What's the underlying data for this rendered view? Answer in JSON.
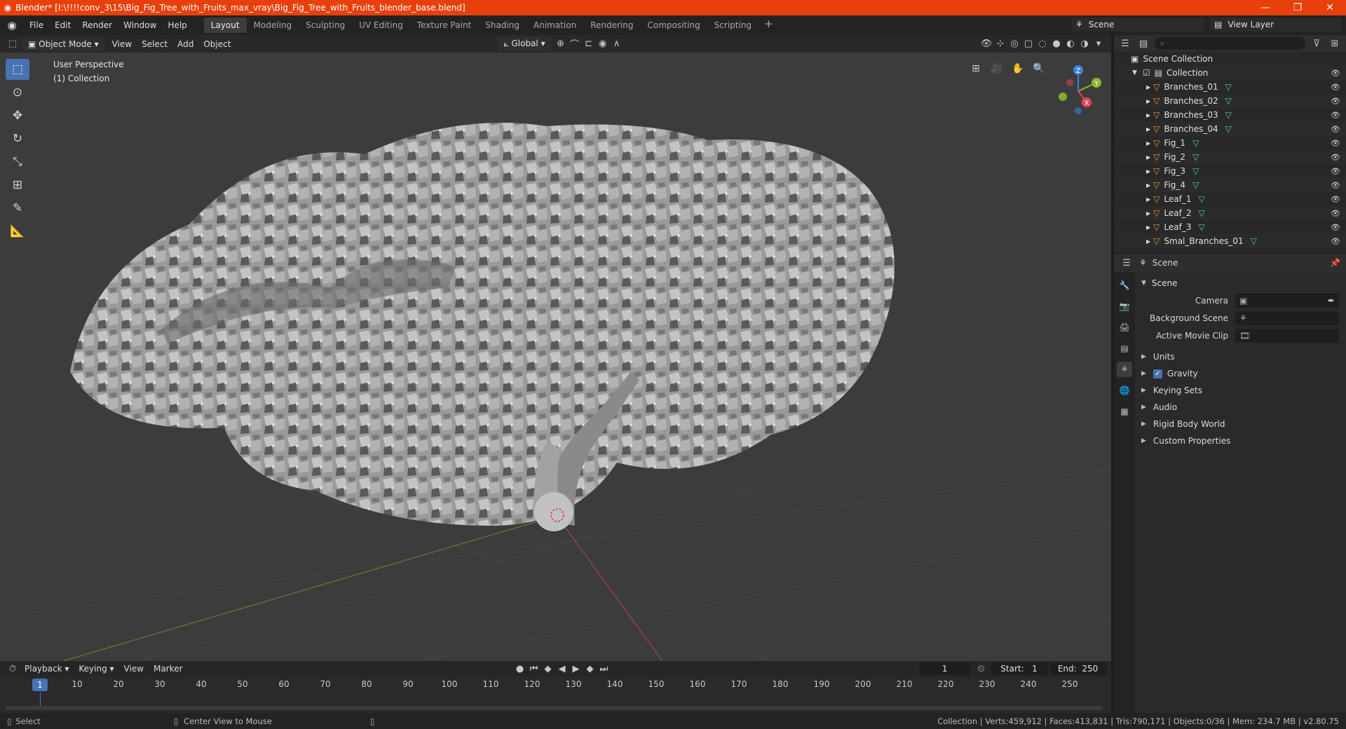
{
  "window": {
    "title": "Blender* [I:\\!!!!conv_3\\15\\Big_Fig_Tree_with_Fruits_max_vray\\Big_Fig_Tree_with_Fruits_blender_base.blend]",
    "minimize": "—",
    "maximize": "❐",
    "close": "✕"
  },
  "menu": {
    "items": [
      "File",
      "Edit",
      "Render",
      "Window",
      "Help"
    ],
    "workspaces": [
      "Layout",
      "Modeling",
      "Sculpting",
      "UV Editing",
      "Texture Paint",
      "Shading",
      "Animation",
      "Rendering",
      "Compositing",
      "Scripting"
    ],
    "active_workspace": "Layout",
    "add": "+"
  },
  "scene_selector": {
    "scene": "Scene",
    "view_layer": "View Layer"
  },
  "viewport": {
    "mode": "Object Mode",
    "menus": [
      "View",
      "Select",
      "Add",
      "Object"
    ],
    "orientation": "Global",
    "info_line1": "User Perspective",
    "info_line2": "(1) Collection",
    "gizmo": {
      "x": "X",
      "y": "Y",
      "z": "Z"
    },
    "colors": {
      "x": "#e8405a",
      "y": "#8ab72c",
      "z": "#3a82e0"
    }
  },
  "outliner": {
    "search_placeholder": "⌕",
    "scene_collection": "Scene Collection",
    "collection": "Collection",
    "objects": [
      "Branches_01",
      "Branches_02",
      "Branches_03",
      "Branches_04",
      "Fig_1",
      "Fig_2",
      "Fig_3",
      "Fig_4",
      "Leaf_1",
      "Leaf_2",
      "Leaf_3",
      "Smal_Branches_01"
    ]
  },
  "properties": {
    "context": "Scene",
    "panel_title": "Scene",
    "camera_label": "Camera",
    "background_scene_label": "Background Scene",
    "active_movie_clip_label": "Active Movie Clip",
    "subpanels": [
      "Units",
      "Gravity",
      "Keying Sets",
      "Audio",
      "Rigid Body World",
      "Custom Properties"
    ],
    "gravity_checked": true
  },
  "timeline": {
    "menus": [
      "Playback",
      "Keying",
      "View",
      "Marker"
    ],
    "current_frame": "1",
    "start_label": "Start:",
    "start": "1",
    "end_label": "End:",
    "end": "250",
    "ruler": [
      "1",
      "10",
      "20",
      "30",
      "40",
      "50",
      "60",
      "70",
      "80",
      "90",
      "100",
      "110",
      "120",
      "130",
      "140",
      "150",
      "160",
      "170",
      "180",
      "190",
      "200",
      "210",
      "220",
      "230",
      "240",
      "250"
    ]
  },
  "status": {
    "left_action": "Select",
    "middle_action": "Center View to Mouse",
    "stats": "Collection | Verts:459,912 | Faces:413,831 | Tris:790,171 | Objects:0/36 | Mem: 234.7 MB | v2.80.75"
  }
}
